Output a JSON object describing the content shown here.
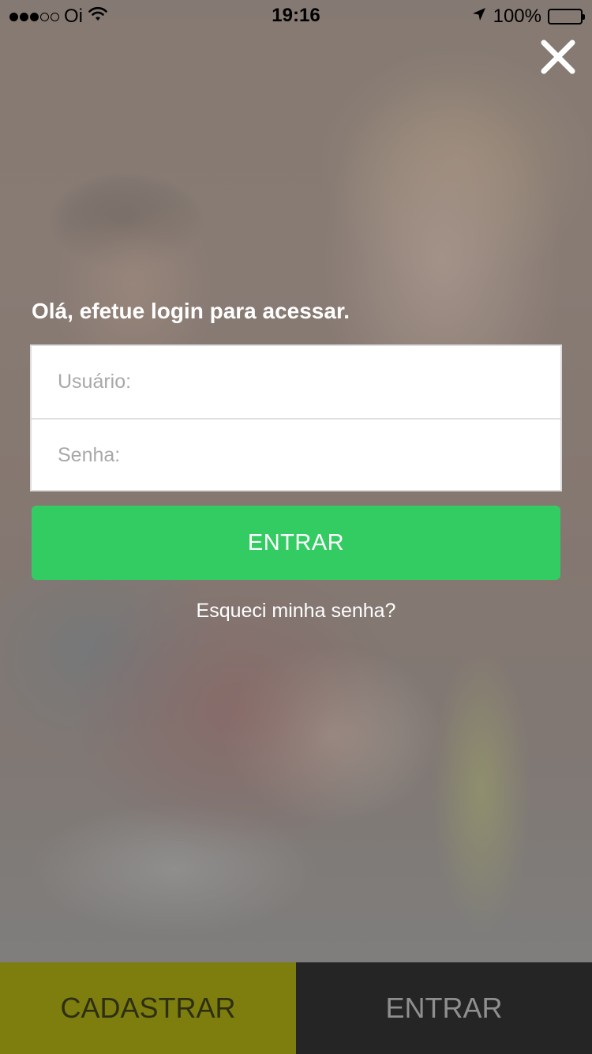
{
  "status_bar": {
    "carrier": "Oi",
    "signal_bars_filled": 3,
    "signal_bars_total": 5,
    "time": "19:16",
    "battery_percent": "100%",
    "icons": [
      "signal-dots-icon",
      "wifi-icon",
      "location-arrow-icon",
      "battery-icon"
    ]
  },
  "close_icon": "close-icon",
  "login": {
    "heading": "Olá, efetue login para acessar.",
    "username_placeholder": "Usuário:",
    "username_value": "",
    "password_placeholder": "Senha:",
    "password_value": "",
    "submit_label": "ENTRAR",
    "forgot_password_label": "Esqueci minha senha?"
  },
  "bottom_tabs": {
    "register_label": "CADASTRAR",
    "login_label": "ENTRAR"
  },
  "colors": {
    "primary_button": "#33cc62",
    "register_tab": "#7e7e0e",
    "login_tab": "#252525"
  }
}
